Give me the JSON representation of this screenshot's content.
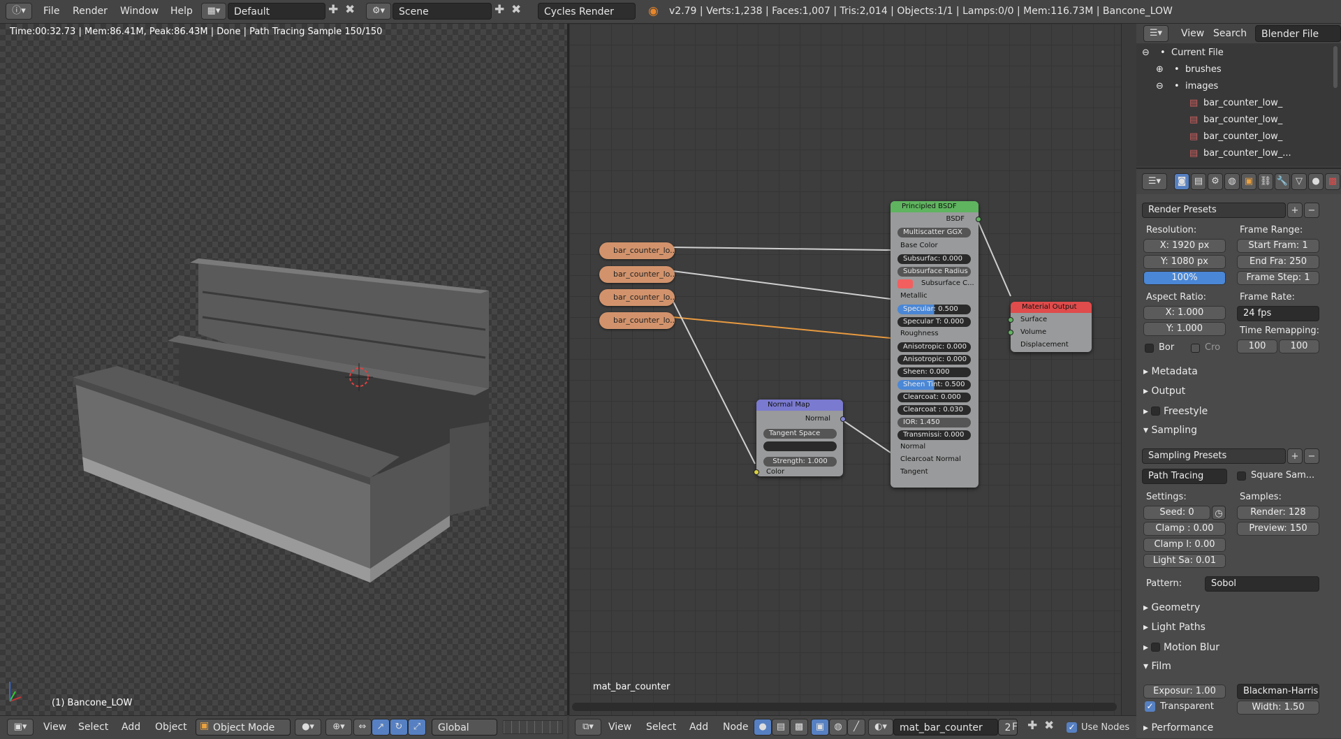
{
  "topbar": {
    "menus": [
      "File",
      "Render",
      "Window",
      "Help"
    ],
    "layout": "Default",
    "scene": "Scene",
    "engine": "Cycles Render",
    "stats": "v2.79 | Verts:1,238 | Faces:1,007 | Tris:2,014 | Objects:1/1 | Lamps:0/0 | Mem:116.73M | Bancone_LOW"
  },
  "viewport": {
    "render_info": "Time:00:32.73 | Mem:86.41M, Peak:86.43M | Done | Path Tracing Sample 150/150",
    "object_label": "(1) Bancone_LOW",
    "menus": [
      "View",
      "Select",
      "Add",
      "Object"
    ],
    "mode": "Object Mode",
    "orientation": "Global"
  },
  "node_editor": {
    "material_label": "mat_bar_counter",
    "menus": [
      "View",
      "Select",
      "Add",
      "Node"
    ],
    "material": "mat_bar_counter",
    "users": "2",
    "fake_user": "F",
    "use_nodes": "Use Nodes",
    "image_nodes": [
      "bar_counter_lo...",
      "bar_counter_lo...",
      "bar_counter_lo...",
      "bar_counter_lo..."
    ],
    "principled": {
      "title": "Principled BSDF",
      "output": "BSDF",
      "distribution": "Multiscatter GGX",
      "inputs": [
        "Base Color",
        "Subsurfac: 0.000",
        "Subsurface Radius",
        "Subsurface C...",
        "Metallic",
        "Specular: 0.500",
        "Specular T: 0.000",
        "Roughness",
        "Anisotropic: 0.000",
        "Anisotropic: 0.000",
        "Sheen: 0.000",
        "Sheen Tint: 0.500",
        "Clearcoat: 0.000",
        "Clearcoat : 0.030",
        "IOR: 1.450",
        "Transmissi: 0.000",
        "Normal",
        "Clearcoat Normal",
        "Tangent"
      ]
    },
    "normal_map": {
      "title": "Normal Map",
      "output": "Normal",
      "space": "Tangent Space",
      "strength": "Strength: 1.000",
      "color": "Color"
    },
    "material_output": {
      "title": "Material Output",
      "inputs": [
        "Surface",
        "Volume",
        "Displacement"
      ]
    },
    "colors": {
      "shader": "#5fb45f",
      "vector": "#8585d6",
      "output": "#e04b4b",
      "image": "#d2936c",
      "link_orange": "#e89a40"
    }
  },
  "outliner": {
    "menus": [
      "View",
      "Search"
    ],
    "display_mode": "Blender File",
    "items": [
      "Current File",
      "brushes",
      "images",
      "bar_counter_low_",
      "bar_counter_low_",
      "bar_counter_low_",
      "bar_counter_low_..."
    ]
  },
  "properties": {
    "render_presets": "Render Presets",
    "resolution_label": "Resolution:",
    "res_x": "X:    1920 px",
    "res_y": "Y:    1080 px",
    "res_pct": "100%",
    "frame_range_label": "Frame Range:",
    "start": "Start Fram:   1",
    "end": "End Fra:  250",
    "step": "Frame Step: 1",
    "aspect_label": "Aspect Ratio:",
    "asp_x": "X:      1.000",
    "asp_y": "Y:      1.000",
    "frame_rate_label": "Frame Rate:",
    "fps": "24 fps",
    "remap_label": "Time Remapping:",
    "remap_old": "100",
    "remap_new": "100",
    "border": "Bor",
    "crop": "Cro",
    "sections": [
      "Metadata",
      "Output",
      "Freestyle",
      "Sampling"
    ],
    "sampling_presets": "Sampling Presets",
    "integrator": "Path Tracing",
    "square_samples": "Square Sam...",
    "settings_label": "Settings:",
    "samples_label": "Samples:",
    "seed": "Seed:     0",
    "clamp1": "Clamp :   0.00",
    "clamp2": "Clamp I:  0.00",
    "light": "Light Sa: 0.01",
    "render_samples": "Render:   128",
    "preview_samples": "Preview:  150",
    "pattern_label": "Pattern:",
    "pattern": "Sobol",
    "sections2": [
      "Geometry",
      "Light Paths",
      "Motion Blur",
      "Film"
    ],
    "exposure": "Exposur: 1.00",
    "filter": "Blackman-Harris",
    "transparent": "Transparent",
    "width": "Width:   1.50",
    "performance": "Performance"
  }
}
